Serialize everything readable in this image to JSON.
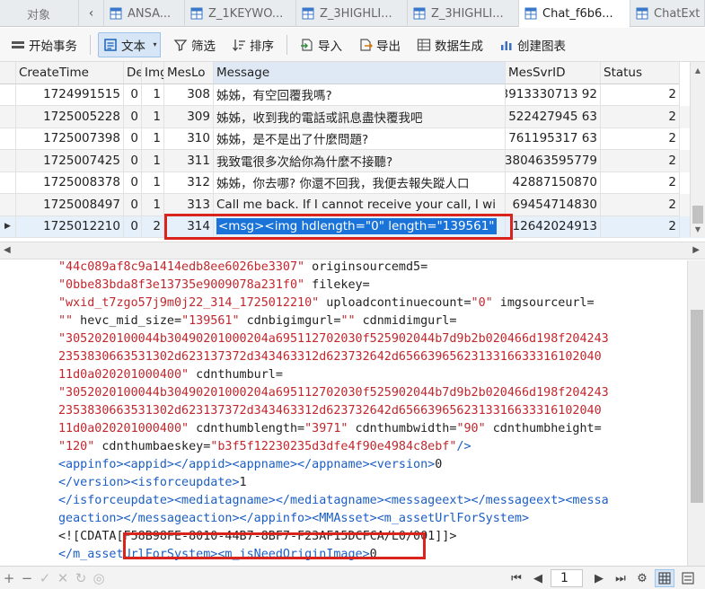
{
  "tabs": [
    {
      "label": "对象",
      "icon": "objects-icon"
    },
    {
      "label": "ANSA...",
      "icon": "table-icon"
    },
    {
      "label": "Z_1KEYWO...",
      "icon": "table-icon"
    },
    {
      "label": "Z_3HIGHLI...",
      "icon": "table-icon"
    },
    {
      "label": "Z_3HIGHLI...",
      "icon": "table-icon"
    },
    {
      "label": "Chat_f6b6...",
      "icon": "table-icon",
      "active": true
    },
    {
      "label": "ChatExt",
      "icon": "table-icon"
    }
  ],
  "toolbar": {
    "begin_transaction": "开始事务",
    "text": "文本",
    "filter": "筛选",
    "sort": "排序",
    "import": "导入",
    "export": "导出",
    "data_generation": "数据生成",
    "create_chart": "创建图表"
  },
  "grid": {
    "columns": [
      "CreateTime",
      "De",
      "Img",
      "MesLo",
      "Message",
      "MesSvrID",
      "Status"
    ],
    "rows": [
      {
        "create": "1724991515",
        "de": "0",
        "img": "1",
        "meslo": "308",
        "msg": "姊姊，有空回覆我嗎?",
        "svr": "3913330713 92",
        "st": "2"
      },
      {
        "create": "1725005228",
        "de": "0",
        "img": "1",
        "meslo": "309",
        "msg": "姊姊，收到我的電話或訊息盡快覆我吧",
        "svr": "522427945 63",
        "st": "2"
      },
      {
        "create": "1725007398",
        "de": "0",
        "img": "1",
        "meslo": "310",
        "msg": "姊姊，是不是出了什麼問題?",
        "svr": "761195317 63",
        "st": "2"
      },
      {
        "create": "1725007425",
        "de": "0",
        "img": "1",
        "meslo": "311",
        "msg": "我致電很多次給你為什麼不接聽?",
        "svr": "380463595779",
        "st": "2"
      },
      {
        "create": "1725008378",
        "de": "0",
        "img": "1",
        "meslo": "312",
        "msg": "姊姊，你去哪? 你還不回我，我便去報失蹤人口",
        "svr": "42887150870",
        "st": "2"
      },
      {
        "create": "1725008497",
        "de": "0",
        "img": "1",
        "meslo": "313",
        "msg": "Call me back. If I cannot receive your call, I wi",
        "svr": "69454714830",
        "st": "2"
      },
      {
        "create": "1725012210",
        "de": "0",
        "img": "2",
        "meslo": "314",
        "msg": "<msg><img hdlength=\"0\" length=\"139561\"",
        "svr": "12642024913",
        "st": "2"
      }
    ]
  },
  "detail": {
    "lines": [
      [
        [
          "s",
          "\"44c089af8c9a1414edb8ee6026be3307\""
        ],
        [
          "a",
          " originsourcemd5="
        ]
      ],
      [
        [
          "s",
          "\"0bbe83bda8f3e13735e9009078a231f0\""
        ],
        [
          "a",
          " filekey="
        ]
      ],
      [
        [
          "s",
          "\"wxid_t7zgo57j9m0j22_314_1725012210\""
        ],
        [
          "a",
          " uploadcontinuecount="
        ],
        [
          "s",
          "\"0\""
        ],
        [
          "a",
          " imgsourceurl="
        ]
      ],
      [
        [
          "s",
          "\"\""
        ],
        [
          "a",
          " hevc_mid_size="
        ],
        [
          "s",
          "\"139561\""
        ],
        [
          "a",
          " cdnbigimgurl="
        ],
        [
          "s",
          "\"\""
        ],
        [
          "a",
          " cdnmidimgurl="
        ]
      ],
      [
        [
          "s",
          "\"3052020100044b30490201000204a695112702030f525902044b7d9b2b020466d198f204243"
        ]
      ],
      [
        [
          "s",
          "2353830663531302d623137372d343463312d623732642d6566396562313316633316102040"
        ]
      ],
      [
        [
          "s",
          "11d0a020201000400\""
        ],
        [
          "a",
          " cdnthumburl="
        ]
      ],
      [
        [
          "s",
          "\"3052020100044b30490201000204a695112702030f525902044b7d9b2b020466d198f204243"
        ]
      ],
      [
        [
          "s",
          "2353830663531302d623137372d343463312d623732642d6566396562313316633316102040"
        ]
      ],
      [
        [
          "s",
          "11d0a020201000400\""
        ],
        [
          "a",
          " cdnthumblength="
        ],
        [
          "s",
          "\"3971\""
        ],
        [
          "a",
          " cdnthumbwidth="
        ],
        [
          "s",
          "\"90\""
        ],
        [
          "a",
          " cdnthumbheight="
        ]
      ],
      [
        [
          "s",
          "\"120\""
        ],
        [
          "a",
          " cdnthumbaeskey="
        ],
        [
          "s",
          "\"b3f5f12230235d3dfe4f90e4984c8ebf\""
        ],
        [
          "t",
          "/>"
        ]
      ],
      [
        [
          "t",
          "<appinfo><appid></appid><appname></appname><version>"
        ],
        [
          "x",
          "0"
        ]
      ],
      [
        [
          "t",
          "</version><isforceupdate>"
        ],
        [
          "x",
          "1"
        ]
      ],
      [
        [
          "t",
          "</isforceupdate><mediatagname></mediatagname><messageext></messageext><messa"
        ]
      ],
      [
        [
          "t",
          "geaction></messageaction></appinfo><MMAsset><m_assetUrlForSystem>"
        ]
      ],
      [
        [
          "x",
          "<![CDATA[F58B98FE-8010-44B7-8BF7-F23AF15DCFCA/L0/001]]>"
        ]
      ],
      [
        [
          "t",
          "</m_assetUrlForSystem><m_isNeedOriginImage>"
        ],
        [
          "x",
          "0"
        ]
      ]
    ]
  },
  "status": {
    "page": "1"
  }
}
